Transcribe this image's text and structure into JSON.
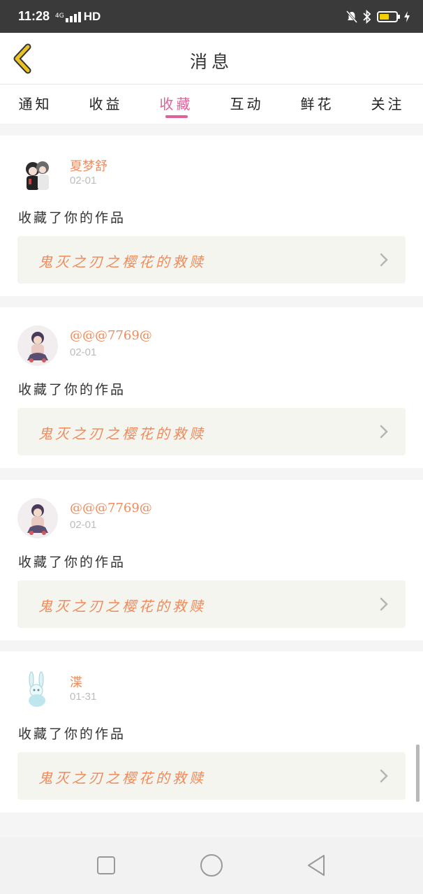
{
  "status_bar": {
    "time": "11:28",
    "network": "4G",
    "hd": "HD",
    "battery_level": 0.5,
    "battery_color": "#f5d000"
  },
  "header": {
    "title": "消息",
    "back_icon": "chevron-left-icon"
  },
  "tabs": [
    {
      "label": "通知",
      "active": false
    },
    {
      "label": "收益",
      "active": false
    },
    {
      "label": "收藏",
      "active": true
    },
    {
      "label": "互动",
      "active": false
    },
    {
      "label": "鲜花",
      "active": false
    },
    {
      "label": "关注",
      "active": false
    }
  ],
  "messages": [
    {
      "name": "夏梦舒",
      "date": "02-01",
      "action": "收藏了你的作品",
      "work": "鬼灭之刃之樱花的救赎"
    },
    {
      "name": "@@@7769@",
      "date": "02-01",
      "action": "收藏了你的作品",
      "work": "鬼灭之刃之樱花的救赎"
    },
    {
      "name": "@@@7769@",
      "date": "02-01",
      "action": "收藏了你的作品",
      "work": "鬼灭之刃之樱花的救赎"
    },
    {
      "name": "渫",
      "date": "01-31",
      "action": "收藏了你的作品",
      "work": "鬼灭之刃之樱花的救赎"
    }
  ],
  "colors": {
    "accent": "#e0609a",
    "name": "#f08a5a",
    "back_icon": "#e8c227"
  }
}
